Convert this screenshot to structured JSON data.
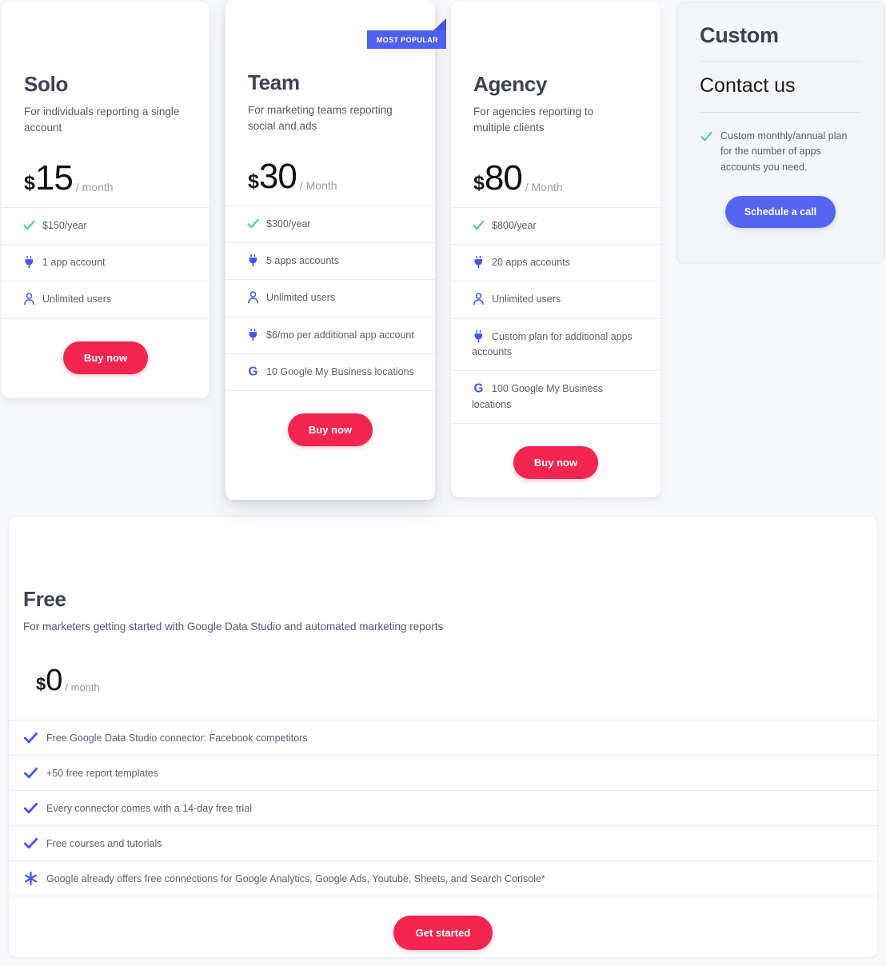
{
  "colors": {
    "page_background": "#f8f9fc",
    "card_background": "#ffffff",
    "custom_card_background": "#f5f6fa",
    "buy_button": "#f3254f",
    "schedule_button": "#5465f0",
    "ribbon": "#4f5ff0",
    "check_green": "#4ad295",
    "icon_blue": "#4355f5",
    "heading": "#3e4155",
    "body_text": "#5c6070",
    "muted_text": "#9b9bab"
  },
  "plans": [
    {
      "id": "solo",
      "name": "Solo",
      "description": "For individuals reporting a single account",
      "currency": "$",
      "amount": "15",
      "period": "/ month",
      "badge": null,
      "features": [
        {
          "icon": "check-green-icon",
          "text": "$150/year"
        },
        {
          "icon": "plug-icon",
          "text": "1 app account"
        },
        {
          "icon": "user-icon",
          "text": "Unlimited users"
        }
      ],
      "cta": "Buy now"
    },
    {
      "id": "team",
      "name": "Team",
      "description": "For marketing teams reporting social and ads",
      "currency": "$",
      "amount": "30",
      "period": "/ Month",
      "badge": "MOST POPULAR",
      "features": [
        {
          "icon": "check-green-icon",
          "text": "$300/year"
        },
        {
          "icon": "plug-icon",
          "text": "5 apps accounts"
        },
        {
          "icon": "user-icon",
          "text": "Unlimited users"
        },
        {
          "icon": "plug-icon",
          "text": "$6/mo per additional app account"
        },
        {
          "icon": "google-g-icon",
          "text": "10 Google My Business locations"
        }
      ],
      "cta": "Buy now"
    },
    {
      "id": "agency",
      "name": "Agency",
      "description": "For agencies reporting to multiple clients",
      "currency": "$",
      "amount": "80",
      "period": "/ Month",
      "badge": null,
      "features": [
        {
          "icon": "check-green-icon",
          "text": "$800/year"
        },
        {
          "icon": "plug-icon",
          "text": "20 apps accounts"
        },
        {
          "icon": "user-icon",
          "text": "Unlimited users"
        },
        {
          "icon": "plug-icon",
          "text": "Custom plan for additional apps accounts"
        },
        {
          "icon": "google-g-icon",
          "text": "100 Google My Business locations"
        }
      ],
      "cta": "Buy now"
    }
  ],
  "custom": {
    "title": "Custom",
    "contact_heading": "Contact us",
    "feature": {
      "icon": "check-green-icon",
      "text": "Custom monthly/annual plan for the number of apps accounts you need."
    },
    "cta": "Schedule a call"
  },
  "free": {
    "title": "Free",
    "description": "For marketers getting started with Google Data Studio and automated marketing reports",
    "currency": "$",
    "amount": "0",
    "period": "/ month",
    "features": [
      {
        "icon": "check-blue-icon",
        "text": "Free Google Data Studio connector: Facebook competitors"
      },
      {
        "icon": "check-blue-icon",
        "text": "+50 free report templates"
      },
      {
        "icon": "check-blue-icon",
        "text": "Every connector comes with a 14-day free trial"
      },
      {
        "icon": "check-blue-icon",
        "text": "Free courses and tutorials"
      },
      {
        "icon": "asterisk-icon",
        "text": "Google already offers free connections for Google Analytics, Google Ads, Youtube, Sheets, and Search Console*"
      }
    ],
    "cta": "Get started"
  }
}
